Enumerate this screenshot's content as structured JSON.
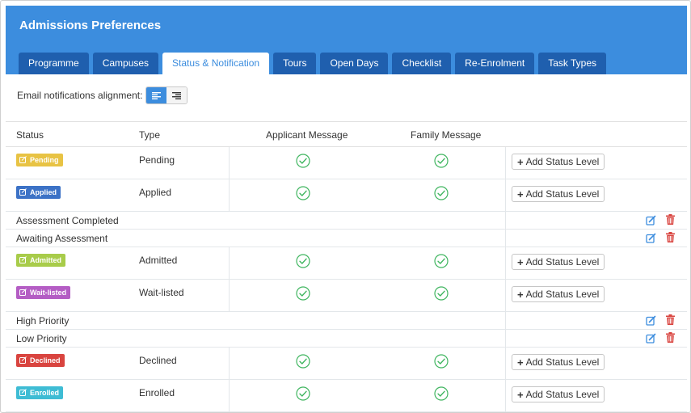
{
  "header": {
    "title": "Admissions Preferences"
  },
  "tabs": [
    {
      "label": "Programme",
      "active": false
    },
    {
      "label": "Campuses",
      "active": false
    },
    {
      "label": "Status & Notification",
      "active": true
    },
    {
      "label": "Tours",
      "active": false
    },
    {
      "label": "Open Days",
      "active": false
    },
    {
      "label": "Checklist",
      "active": false
    },
    {
      "label": "Re-Enrolment",
      "active": false
    },
    {
      "label": "Task Types",
      "active": false
    }
  ],
  "alignment": {
    "label": "Email notifications alignment:",
    "selected": "left"
  },
  "table": {
    "columns": {
      "status": "Status",
      "type": "Type",
      "applicant": "Applicant Message",
      "family": "Family Message"
    },
    "add_label": "Add Status Level",
    "rows": [
      {
        "kind": "status",
        "badge": "Pending",
        "color": "#e8c344",
        "type": "Pending",
        "applicant": true,
        "family": true
      },
      {
        "kind": "status",
        "badge": "Applied",
        "color": "#3c72c6",
        "type": "Applied",
        "applicant": true,
        "family": true
      },
      {
        "kind": "level",
        "label": "Assessment Completed"
      },
      {
        "kind": "level",
        "label": "Awaiting Assessment"
      },
      {
        "kind": "status",
        "badge": "Admitted",
        "color": "#a8cc4a",
        "type": "Admitted",
        "applicant": true,
        "family": true
      },
      {
        "kind": "status",
        "badge": "Wait-listed",
        "color": "#b45dc4",
        "type": "Wait-listed",
        "applicant": true,
        "family": true
      },
      {
        "kind": "level",
        "label": "High Priority"
      },
      {
        "kind": "level",
        "label": "Low Priority"
      },
      {
        "kind": "status",
        "badge": "Declined",
        "color": "#d9443f",
        "type": "Declined",
        "applicant": true,
        "family": true
      },
      {
        "kind": "status",
        "badge": "Enrolled",
        "color": "#3ebcd4",
        "type": "Enrolled",
        "applicant": true,
        "family": true
      }
    ]
  },
  "colors": {
    "accent": "#3c8dde",
    "tab_dark": "#1f5fae",
    "check_green": "#3fb55f",
    "edit_blue": "#3c8dde",
    "trash_red": "#d9443f"
  },
  "icons": {
    "check": "check-circle-icon",
    "edit": "edit-icon",
    "trash": "trash-icon",
    "badge": "edit-square-icon"
  }
}
